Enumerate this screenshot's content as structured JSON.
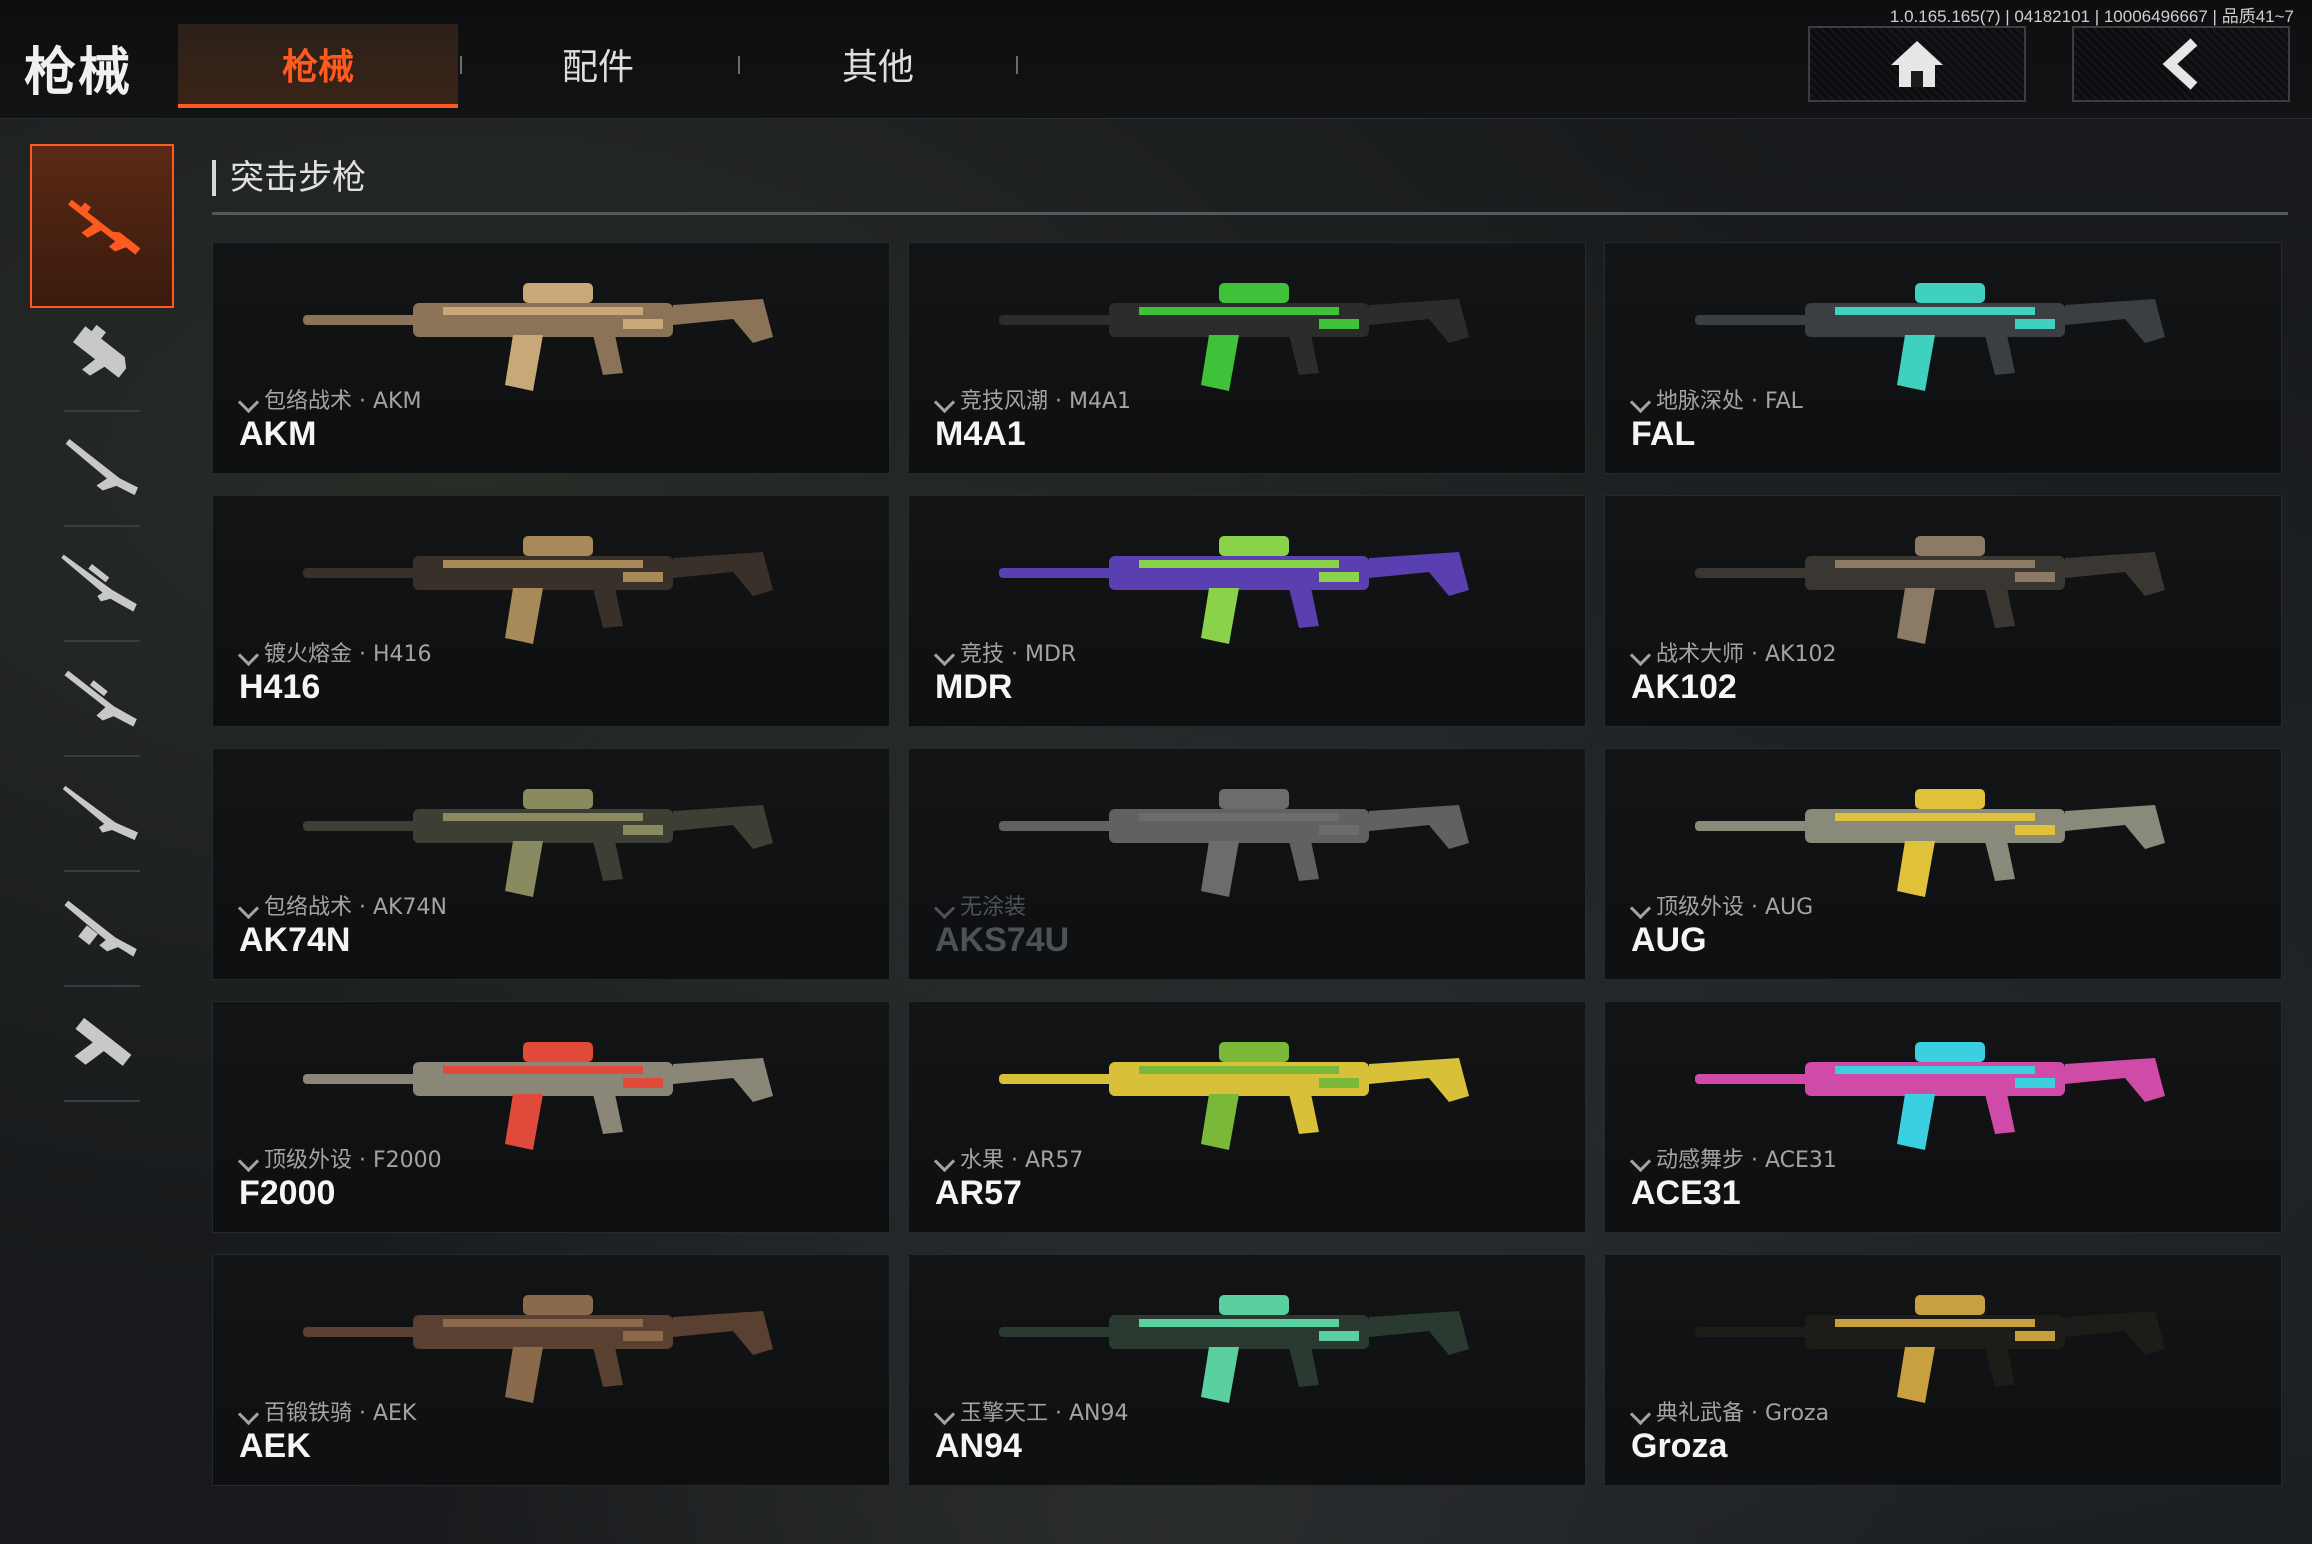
{
  "version": "1.0.165.165(7) | 04182101 | 10006496667 | 品质41~7",
  "header": {
    "title": "枪械",
    "tabs": [
      {
        "label": "枪械",
        "active": true
      },
      {
        "label": "配件",
        "active": false
      },
      {
        "label": "其他",
        "active": false
      }
    ],
    "home_icon": "home-icon",
    "back_icon": "back-icon"
  },
  "sidebar": {
    "items": [
      {
        "icon": "assault-rifle-icon",
        "active": true
      },
      {
        "icon": "smg-icon",
        "active": false
      },
      {
        "icon": "shotgun-icon",
        "active": false
      },
      {
        "icon": "sniper-rifle-icon",
        "active": false
      },
      {
        "icon": "marksman-rifle-icon",
        "active": false
      },
      {
        "icon": "rifle-icon",
        "active": false
      },
      {
        "icon": "lmg-icon",
        "active": false
      },
      {
        "icon": "pistol-icon",
        "active": false
      }
    ]
  },
  "section": {
    "title": "突击步枪"
  },
  "weapons": [
    {
      "name": "AKM",
      "skin": "包络战术 · AKM",
      "color": "#8a7356",
      "accent": "#c8a878",
      "dim": false
    },
    {
      "name": "M4A1",
      "skin": "竞技风潮 · M4A1",
      "color": "#2a2d2a",
      "accent": "#3fc23a",
      "dim": false
    },
    {
      "name": "FAL",
      "skin": "地脉深处 · FAL",
      "color": "#3b3f44",
      "accent": "#3fd0c0",
      "dim": false
    },
    {
      "name": "H416",
      "skin": "镀火熔金 · H416",
      "color": "#3a302a",
      "accent": "#a88a5a",
      "dim": false
    },
    {
      "name": "MDR",
      "skin": "竞技 · MDR",
      "color": "#5a3fb0",
      "accent": "#8ad24a",
      "dim": false
    },
    {
      "name": "AK102",
      "skin": "战术大师 · AK102",
      "color": "#3a3632",
      "accent": "#8a7a66",
      "dim": false
    },
    {
      "name": "AK74N",
      "skin": "包络战术 · AK74N",
      "color": "#3d3f34",
      "accent": "#8a8a60",
      "dim": false
    },
    {
      "name": "AKS74U",
      "skin": "无涂装",
      "color": "#5f6163",
      "accent": "#6a6c6e",
      "dim": true
    },
    {
      "name": "AUG",
      "skin": "顶级外设 · AUG",
      "color": "#8a8a7a",
      "accent": "#e0c23a",
      "dim": false
    },
    {
      "name": "F2000",
      "skin": "顶级外设 · F2000",
      "color": "#8a8678",
      "accent": "#e04a3a",
      "dim": false
    },
    {
      "name": "AR57",
      "skin": "水果 · AR57",
      "color": "#d8c038",
      "accent": "#7ab83a",
      "dim": false
    },
    {
      "name": "ACE31",
      "skin": "动感舞步 · ACE31",
      "color": "#d04aa8",
      "accent": "#3ad0e0",
      "dim": false
    },
    {
      "name": "AEK",
      "skin": "百锻铁骑 · AEK",
      "color": "#5a4030",
      "accent": "#8a6a4a",
      "dim": false
    },
    {
      "name": "AN94",
      "skin": "玉擎天工 · AN94",
      "color": "#2a3a30",
      "accent": "#5ad0a0",
      "dim": false
    },
    {
      "name": "Groza",
      "skin": "典礼武备 · Groza",
      "color": "#1e1c18",
      "accent": "#c8a040",
      "dim": false
    }
  ]
}
